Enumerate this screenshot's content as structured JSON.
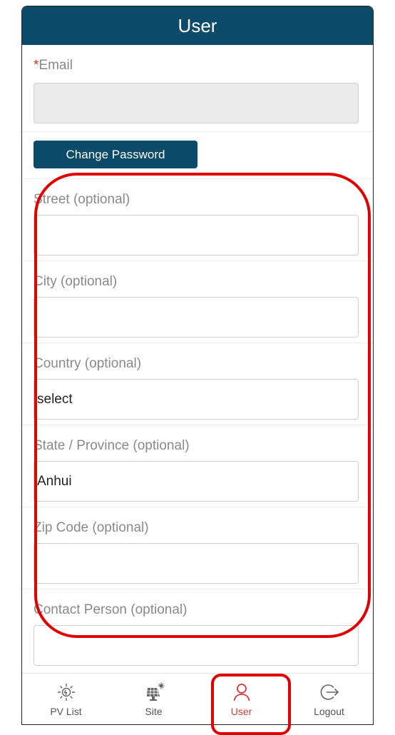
{
  "header": {
    "title": "User"
  },
  "form": {
    "email": {
      "required_mark": "*",
      "label": "Email",
      "value": ""
    },
    "change_password_label": "Change Password",
    "street": {
      "label": "Street (optional)",
      "value": ""
    },
    "city": {
      "label": "City (optional)",
      "value": ""
    },
    "country": {
      "label": "Country (optional)",
      "value": "select"
    },
    "state": {
      "label": "State / Province (optional)",
      "value": "Anhui"
    },
    "zip": {
      "label": "Zip Code (optional)",
      "value": ""
    },
    "contact": {
      "label": "Contact Person (optional)",
      "value": ""
    }
  },
  "tabs": [
    {
      "label": "PV List",
      "icon": "sun-icon"
    },
    {
      "label": "Site",
      "icon": "solar-panel-icon"
    },
    {
      "label": "User",
      "icon": "user-icon"
    },
    {
      "label": "Logout",
      "icon": "logout-icon"
    }
  ],
  "colors": {
    "header": "#0b4a68",
    "active_tab": "#d13b3b",
    "highlight": "#e00000"
  }
}
